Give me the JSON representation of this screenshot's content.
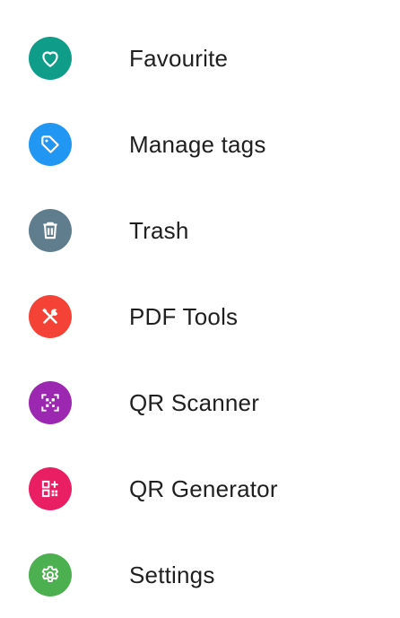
{
  "menu": {
    "items": [
      {
        "label": "Favourite",
        "icon": "heart-icon",
        "color": "#0F9D8A"
      },
      {
        "label": "Manage tags",
        "icon": "tag-icon",
        "color": "#2196F3"
      },
      {
        "label": "Trash",
        "icon": "trash-icon",
        "color": "#5F7D8C"
      },
      {
        "label": "PDF Tools",
        "icon": "tools-icon",
        "color": "#F44336"
      },
      {
        "label": "QR Scanner",
        "icon": "qr-scan-icon",
        "color": "#9C27B0"
      },
      {
        "label": "QR Generator",
        "icon": "qr-generate-icon",
        "color": "#E91E63"
      },
      {
        "label": "Settings",
        "icon": "gear-icon",
        "color": "#4CAF50"
      }
    ]
  }
}
